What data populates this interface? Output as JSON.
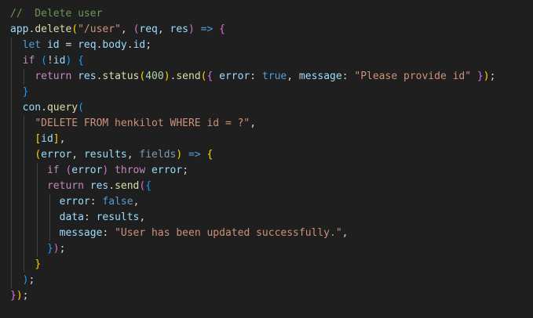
{
  "editor": {
    "lines": [
      {
        "indent": 0,
        "tokens": [
          {
            "t": "//  Delete user",
            "c": "comment"
          }
        ]
      },
      {
        "indent": 0,
        "tokens": [
          {
            "t": "app",
            "c": "variable"
          },
          {
            "t": ".",
            "c": "punct"
          },
          {
            "t": "delete",
            "c": "function"
          },
          {
            "t": "(",
            "c": "b1"
          },
          {
            "t": "\"/user\"",
            "c": "string"
          },
          {
            "t": ", ",
            "c": "punct"
          },
          {
            "t": "(",
            "c": "b2"
          },
          {
            "t": "req",
            "c": "param"
          },
          {
            "t": ", ",
            "c": "punct"
          },
          {
            "t": "res",
            "c": "param"
          },
          {
            "t": ")",
            "c": "b2"
          },
          {
            "t": " ",
            "c": "punct"
          },
          {
            "t": "=>",
            "c": "storage"
          },
          {
            "t": " ",
            "c": "punct"
          },
          {
            "t": "{",
            "c": "b2"
          }
        ]
      },
      {
        "indent": 1,
        "tokens": [
          {
            "t": "let",
            "c": "storage"
          },
          {
            "t": " ",
            "c": "punct"
          },
          {
            "t": "id",
            "c": "variable"
          },
          {
            "t": " = ",
            "c": "punct"
          },
          {
            "t": "req",
            "c": "variable"
          },
          {
            "t": ".",
            "c": "punct"
          },
          {
            "t": "body",
            "c": "variable"
          },
          {
            "t": ".",
            "c": "punct"
          },
          {
            "t": "id",
            "c": "variable"
          },
          {
            "t": ";",
            "c": "punct"
          }
        ]
      },
      {
        "indent": 1,
        "tokens": [
          {
            "t": "if",
            "c": "keyword"
          },
          {
            "t": " ",
            "c": "punct"
          },
          {
            "t": "(",
            "c": "b3"
          },
          {
            "t": "!",
            "c": "punct"
          },
          {
            "t": "id",
            "c": "variable"
          },
          {
            "t": ")",
            "c": "b3"
          },
          {
            "t": " ",
            "c": "punct"
          },
          {
            "t": "{",
            "c": "b3"
          }
        ]
      },
      {
        "indent": 2,
        "tokens": [
          {
            "t": "return",
            "c": "keyword"
          },
          {
            "t": " ",
            "c": "punct"
          },
          {
            "t": "res",
            "c": "variable"
          },
          {
            "t": ".",
            "c": "punct"
          },
          {
            "t": "status",
            "c": "function"
          },
          {
            "t": "(",
            "c": "b1"
          },
          {
            "t": "400",
            "c": "number"
          },
          {
            "t": ")",
            "c": "b1"
          },
          {
            "t": ".",
            "c": "punct"
          },
          {
            "t": "send",
            "c": "function"
          },
          {
            "t": "(",
            "c": "b1"
          },
          {
            "t": "{",
            "c": "b2"
          },
          {
            "t": " ",
            "c": "punct"
          },
          {
            "t": "error",
            "c": "variable"
          },
          {
            "t": ": ",
            "c": "punct"
          },
          {
            "t": "true",
            "c": "boolean"
          },
          {
            "t": ", ",
            "c": "punct"
          },
          {
            "t": "message",
            "c": "variable"
          },
          {
            "t": ": ",
            "c": "punct"
          },
          {
            "t": "\"Please provide id\"",
            "c": "string"
          },
          {
            "t": " ",
            "c": "punct"
          },
          {
            "t": "}",
            "c": "b2"
          },
          {
            "t": ")",
            "c": "b1"
          },
          {
            "t": ";",
            "c": "punct"
          }
        ]
      },
      {
        "indent": 1,
        "tokens": [
          {
            "t": "}",
            "c": "b3"
          }
        ]
      },
      {
        "indent": 1,
        "tokens": [
          {
            "t": "con",
            "c": "variable"
          },
          {
            "t": ".",
            "c": "punct"
          },
          {
            "t": "query",
            "c": "function"
          },
          {
            "t": "(",
            "c": "b3"
          }
        ]
      },
      {
        "indent": 2,
        "tokens": [
          {
            "t": "\"DELETE FROM henkilot WHERE id = ?\"",
            "c": "string"
          },
          {
            "t": ",",
            "c": "punct"
          }
        ]
      },
      {
        "indent": 2,
        "tokens": [
          {
            "t": "[",
            "c": "b1"
          },
          {
            "t": "id",
            "c": "variable"
          },
          {
            "t": "]",
            "c": "b1"
          },
          {
            "t": ",",
            "c": "punct"
          }
        ]
      },
      {
        "indent": 2,
        "tokens": [
          {
            "t": "(",
            "c": "b1"
          },
          {
            "t": "error",
            "c": "param"
          },
          {
            "t": ", ",
            "c": "punct"
          },
          {
            "t": "results",
            "c": "param"
          },
          {
            "t": ", ",
            "c": "punct"
          },
          {
            "t": "fields",
            "c": "faded"
          },
          {
            "t": ")",
            "c": "b1"
          },
          {
            "t": " ",
            "c": "punct"
          },
          {
            "t": "=>",
            "c": "storage"
          },
          {
            "t": " ",
            "c": "punct"
          },
          {
            "t": "{",
            "c": "b1"
          }
        ]
      },
      {
        "indent": 3,
        "tokens": [
          {
            "t": "if",
            "c": "keyword"
          },
          {
            "t": " ",
            "c": "punct"
          },
          {
            "t": "(",
            "c": "b2"
          },
          {
            "t": "error",
            "c": "variable"
          },
          {
            "t": ")",
            "c": "b2"
          },
          {
            "t": " ",
            "c": "punct"
          },
          {
            "t": "throw",
            "c": "keyword"
          },
          {
            "t": " ",
            "c": "punct"
          },
          {
            "t": "error",
            "c": "variable"
          },
          {
            "t": ";",
            "c": "punct"
          }
        ]
      },
      {
        "indent": 3,
        "tokens": [
          {
            "t": "return",
            "c": "keyword"
          },
          {
            "t": " ",
            "c": "punct"
          },
          {
            "t": "res",
            "c": "variable"
          },
          {
            "t": ".",
            "c": "punct"
          },
          {
            "t": "send",
            "c": "function"
          },
          {
            "t": "(",
            "c": "b2"
          },
          {
            "t": "{",
            "c": "b3"
          }
        ]
      },
      {
        "indent": 4,
        "tokens": [
          {
            "t": "error",
            "c": "variable"
          },
          {
            "t": ": ",
            "c": "punct"
          },
          {
            "t": "false",
            "c": "boolean"
          },
          {
            "t": ",",
            "c": "punct"
          }
        ]
      },
      {
        "indent": 4,
        "tokens": [
          {
            "t": "data",
            "c": "variable"
          },
          {
            "t": ": ",
            "c": "punct"
          },
          {
            "t": "results",
            "c": "variable"
          },
          {
            "t": ",",
            "c": "punct"
          }
        ]
      },
      {
        "indent": 4,
        "tokens": [
          {
            "t": "message",
            "c": "variable"
          },
          {
            "t": ": ",
            "c": "punct"
          },
          {
            "t": "\"User has been updated successfully.\"",
            "c": "string"
          },
          {
            "t": ",",
            "c": "punct"
          }
        ]
      },
      {
        "indent": 3,
        "tokens": [
          {
            "t": "}",
            "c": "b3"
          },
          {
            "t": ")",
            "c": "b2"
          },
          {
            "t": ";",
            "c": "punct"
          }
        ]
      },
      {
        "indent": 2,
        "tokens": [
          {
            "t": "}",
            "c": "b1"
          }
        ]
      },
      {
        "indent": 1,
        "tokens": [
          {
            "t": ")",
            "c": "b3"
          },
          {
            "t": ";",
            "c": "punct"
          }
        ]
      },
      {
        "indent": 0,
        "tokens": [
          {
            "t": "}",
            "c": "b2"
          },
          {
            "t": ")",
            "c": "b1"
          },
          {
            "t": ";",
            "c": "punct"
          }
        ]
      }
    ]
  },
  "colors": {
    "background": "#1f1f1f",
    "comment": "#6a9955",
    "keyword": "#c586c0",
    "storage": "#569cd6",
    "variable": "#9cdcfe",
    "function": "#dcdcaa",
    "string": "#ce9178",
    "number": "#b5cea8",
    "bracket_gold": "#ffd700",
    "bracket_orchid": "#da70d6",
    "bracket_blue": "#179fff",
    "indent_guide": "#404040"
  }
}
